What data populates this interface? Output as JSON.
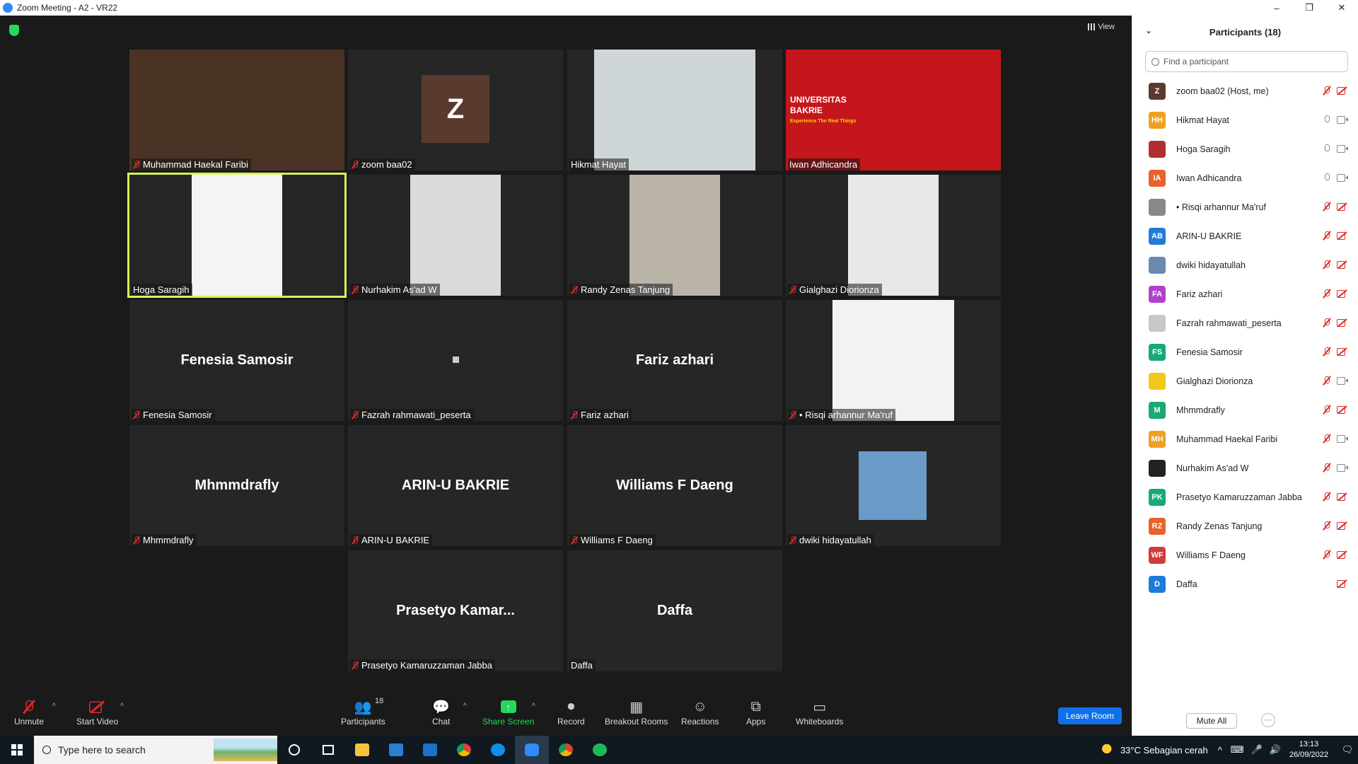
{
  "window": {
    "title": "Zoom Meeting - A2 - VR22",
    "controls": [
      "–",
      "❐",
      "✕"
    ]
  },
  "view_button": "View",
  "tiles": [
    {
      "name": "Muhammad Haekal Faribi",
      "big": "",
      "muted": true,
      "kind": "video",
      "bg": "#4a3324"
    },
    {
      "name": "zoom baa02",
      "big": "",
      "muted": true,
      "kind": "avatar",
      "letter": "Z"
    },
    {
      "name": "Hikmat Hayat",
      "big": "",
      "muted": false,
      "kind": "video",
      "bg": "#cfd6d8"
    },
    {
      "name": "Iwan Adhicandra",
      "big": "",
      "muted": false,
      "kind": "video",
      "bg": "#c4161c"
    },
    {
      "name": "Hoga Saragih",
      "big": "",
      "muted": false,
      "kind": "video",
      "bg": "#f4f4f4",
      "active": true
    },
    {
      "name": "Nurhakim As'ad W",
      "big": "",
      "muted": true,
      "kind": "video",
      "bg": "#dadada"
    },
    {
      "name": "Randy Zenas Tanjung",
      "big": "",
      "muted": true,
      "kind": "video",
      "bg": "#b9b3a8"
    },
    {
      "name": "Gialghazi Diorionza",
      "big": "",
      "muted": true,
      "kind": "video",
      "bg": "#e8e8e8"
    },
    {
      "name": "Fenesia Samosir",
      "big": "Fenesia Samosir",
      "muted": true,
      "kind": "name"
    },
    {
      "name": "Fazrah rahmawati_peserta",
      "big": "",
      "muted": true,
      "kind": "dot"
    },
    {
      "name": "Fariz azhari",
      "big": "Fariz azhari",
      "muted": true,
      "kind": "name"
    },
    {
      "name": "• Risqi arhannur Ma'ruf",
      "big": "",
      "muted": true,
      "kind": "video",
      "bg": "#f2f2f2"
    },
    {
      "name": "Mhmmdrafly",
      "big": "Mhmmdrafly",
      "muted": true,
      "kind": "name"
    },
    {
      "name": "ARIN-U BAKRIE",
      "big": "ARIN-U BAKRIE",
      "muted": true,
      "kind": "name"
    },
    {
      "name": "Williams F Daeng",
      "big": "Williams F Daeng",
      "muted": true,
      "kind": "name"
    },
    {
      "name": "dwiki hidayatullah",
      "big": "",
      "muted": true,
      "kind": "photo",
      "bg": "#6a9ac8"
    },
    {
      "name": "Prasetyo Kamaruzzaman Jabba",
      "big": "Prasetyo Kamar...",
      "muted": true,
      "kind": "name"
    },
    {
      "name": "Daffa",
      "big": "Daffa",
      "muted": false,
      "kind": "name"
    }
  ],
  "iwan_overlay": {
    "line1": "UNIVERSITAS",
    "line2": "BAKRIE",
    "line3": "Experience The Real Things"
  },
  "toolbar": {
    "unmute": "Unmute",
    "start_video": "Start Video",
    "participants": "Participants",
    "participants_count": "18",
    "chat": "Chat",
    "share_screen": "Share Screen",
    "record": "Record",
    "breakout_rooms": "Breakout Rooms",
    "reactions": "Reactions",
    "apps": "Apps",
    "whiteboards": "Whiteboards",
    "leave": "Leave Room"
  },
  "panel": {
    "title": "Participants (18)",
    "search_placeholder": "Find a participant",
    "mute_all": "Mute All",
    "more": "···",
    "participants": [
      {
        "initials": "Z",
        "color": "#5a3a2e",
        "name": "zoom baa02 (Host, me)",
        "mic": "off",
        "cam": "off"
      },
      {
        "initials": "HH",
        "color": "#f0a020",
        "name": "Hikmat Hayat",
        "mic": "on",
        "cam": "on"
      },
      {
        "initials": "",
        "color": "#b03030",
        "name": "Hoga Saragih",
        "mic": "on",
        "cam": "on"
      },
      {
        "initials": "IA",
        "color": "#e8622a",
        "name": "Iwan Adhicandra",
        "mic": "on",
        "cam": "on"
      },
      {
        "initials": "",
        "color": "#888888",
        "name": "• Risqi arhannur Ma'ruf",
        "mic": "off",
        "cam": "off"
      },
      {
        "initials": "AB",
        "color": "#1f7bd8",
        "name": "ARIN-U BAKRIE",
        "mic": "off",
        "cam": "off"
      },
      {
        "initials": "",
        "color": "#6a8ab0",
        "name": "dwiki hidayatullah",
        "mic": "off",
        "cam": "off"
      },
      {
        "initials": "FA",
        "color": "#b040c8",
        "name": "Fariz azhari",
        "mic": "off",
        "cam": "off"
      },
      {
        "initials": "",
        "color": "#c8c8c8",
        "name": "Fazrah rahmawati_peserta",
        "mic": "off",
        "cam": "off"
      },
      {
        "initials": "FS",
        "color": "#19a974",
        "name": "Fenesia Samosir",
        "mic": "off",
        "cam": "off"
      },
      {
        "initials": "",
        "color": "#f2c81a",
        "name": "Gialghazi Diorionza",
        "mic": "off",
        "cam": "on"
      },
      {
        "initials": "M",
        "color": "#19a974",
        "name": "Mhmmdrafly",
        "mic": "off",
        "cam": "off"
      },
      {
        "initials": "MH",
        "color": "#f0a020",
        "name": "Muhammad Haekal Faribi",
        "mic": "off",
        "cam": "on"
      },
      {
        "initials": "",
        "color": "#222222",
        "name": "Nurhakim As'ad W",
        "mic": "off",
        "cam": "on"
      },
      {
        "initials": "PK",
        "color": "#19a974",
        "name": "Prasetyo Kamaruzzaman Jabba",
        "mic": "off",
        "cam": "off"
      },
      {
        "initials": "RZ",
        "color": "#e8622a",
        "name": "Randy Zenas Tanjung",
        "mic": "off",
        "cam": "off"
      },
      {
        "initials": "WF",
        "color": "#d03a3a",
        "name": "Williams F Daeng",
        "mic": "off",
        "cam": "off"
      },
      {
        "initials": "D",
        "color": "#1f7bd8",
        "name": "Daffa",
        "mic": "none",
        "cam": "off"
      }
    ]
  },
  "taskbar": {
    "search_text": "Type here to search",
    "weather": "33°C  Sebagian cerah",
    "time": "13:13",
    "date": "26/09/2022"
  }
}
